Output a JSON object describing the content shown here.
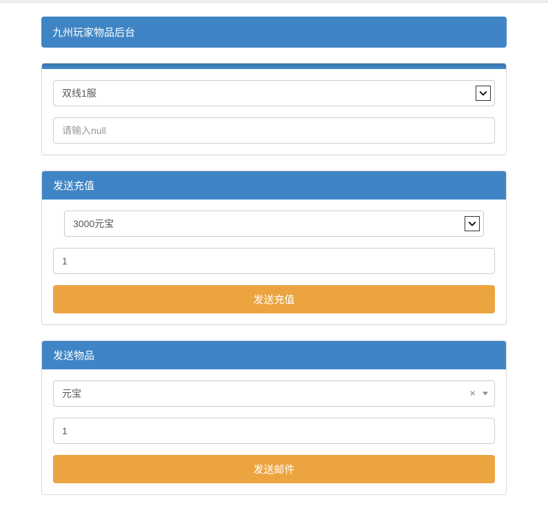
{
  "header": {
    "title": "九州玩家物品后台"
  },
  "serverPanel": {
    "serverSelect": {
      "selected": "双线1服"
    },
    "playerInput": {
      "placeholder": "请输入null",
      "value": ""
    }
  },
  "rechargePanel": {
    "title": "发送充值",
    "amountSelect": {
      "selected": "3000元宝"
    },
    "countInput": {
      "value": "1"
    },
    "submitButton": "发送充值"
  },
  "itemPanel": {
    "title": "发送物品",
    "itemSelect": {
      "selected": "元宝"
    },
    "countInput": {
      "value": "1"
    },
    "submitButton": "发送邮件"
  }
}
